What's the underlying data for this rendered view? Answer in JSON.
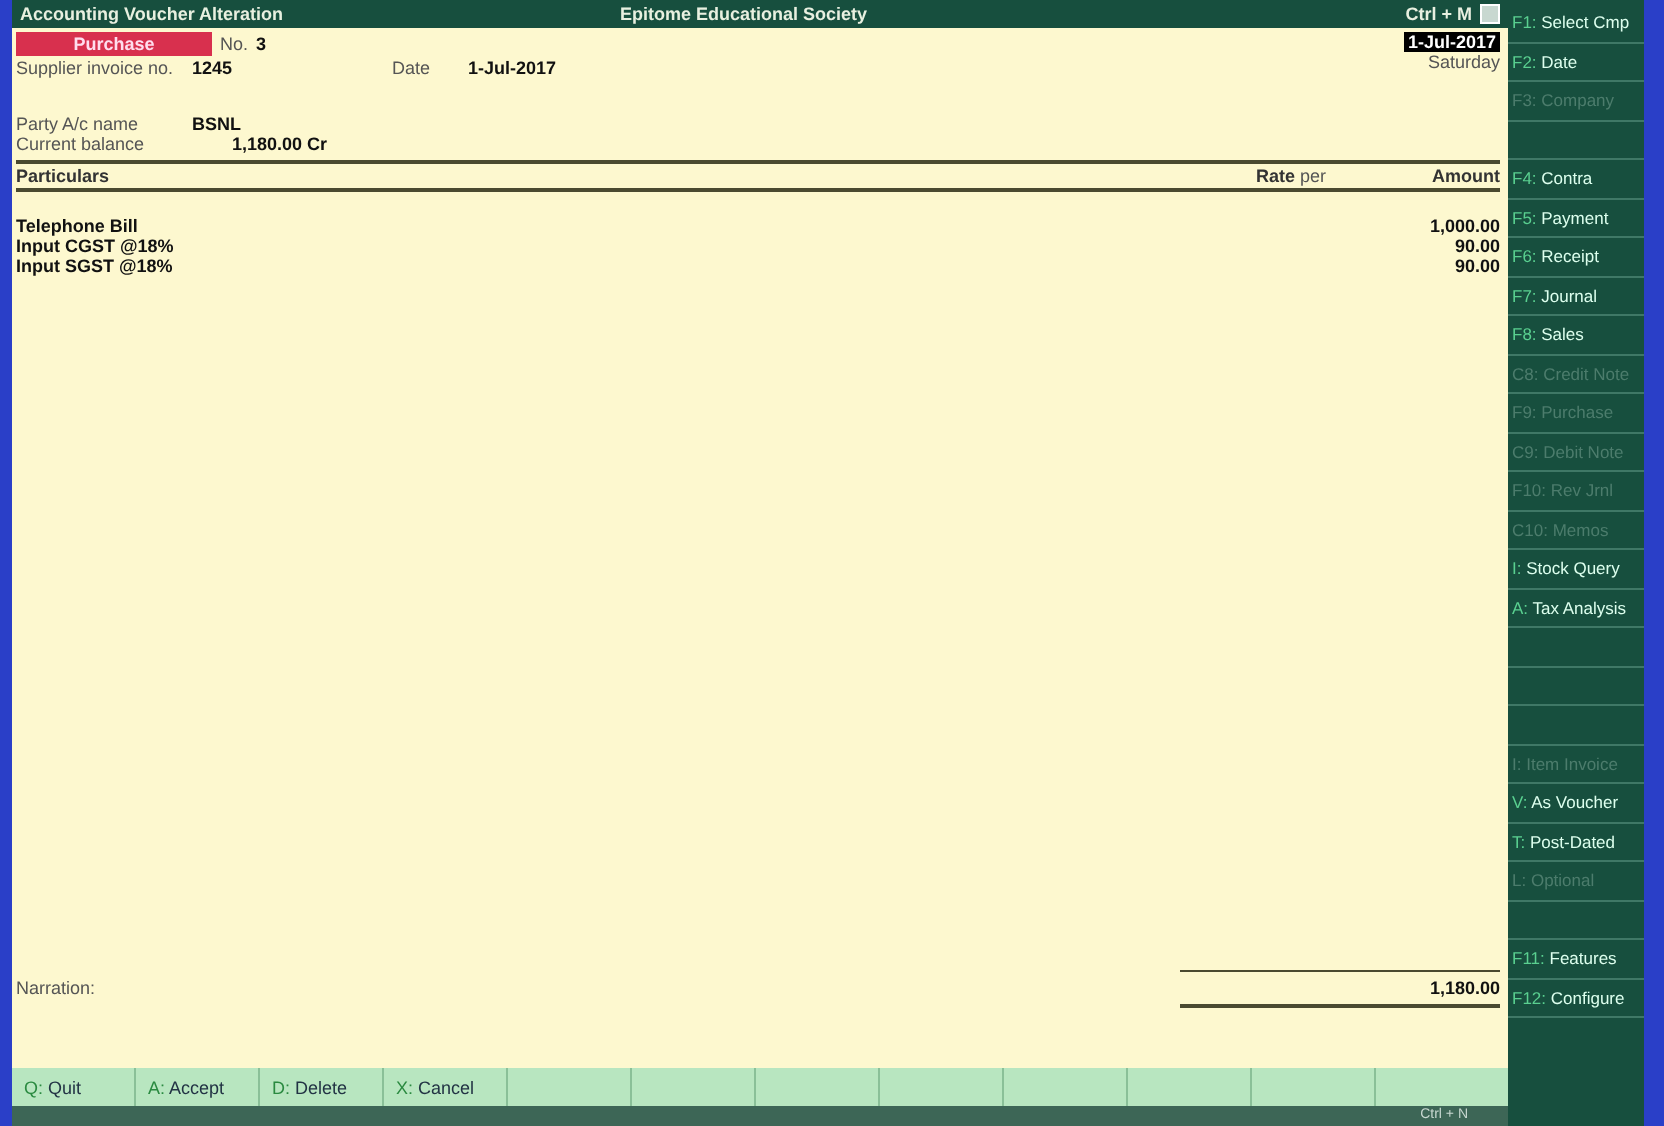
{
  "title_bar": {
    "left": "Accounting Voucher  Alteration",
    "center": "Epitome Educational Society",
    "right": "Ctrl + M"
  },
  "voucher": {
    "type": "Purchase",
    "number_label": "No.",
    "number": "3",
    "date": "1-Jul-2017",
    "day": "Saturday",
    "fields": [
      {
        "label": "Supplier invoice no.",
        "value": "1245"
      },
      {
        "label": "Date",
        "value": "1-Jul-2017"
      }
    ],
    "party": [
      {
        "label": "Party A/c name",
        "value": "BSNL"
      },
      {
        "label": "Current balance",
        "value": "1,180.00 Cr"
      }
    ]
  },
  "table": {
    "columns": [
      "Particulars",
      "Rate",
      "per",
      "Amount"
    ],
    "rows": [
      {
        "particulars": "Telephone Bill",
        "amount": "1,000.00"
      },
      {
        "particulars": "Input CGST @18%",
        "amount": "90.00"
      },
      {
        "particulars": "Input SGST @18%",
        "amount": "90.00"
      }
    ]
  },
  "narration": {
    "label": "Narration:",
    "total": "1,180.00"
  },
  "bottom_buttons": [
    {
      "key": "Q:",
      "label": "Quit"
    },
    {
      "key": "A:",
      "label": "Accept"
    },
    {
      "key": "D:",
      "label": "Delete"
    },
    {
      "key": "X:",
      "label": "Cancel"
    }
  ],
  "status_bar": {
    "text": "Ctrl + N"
  },
  "sidebar": [
    {
      "kind": "button",
      "key": "F1:",
      "label": "Select Cmp",
      "disabled": false
    },
    {
      "kind": "button",
      "key": "F2:",
      "label": "Date",
      "disabled": false
    },
    {
      "kind": "button",
      "key": "F3:",
      "label": "Company",
      "disabled": true
    },
    {
      "kind": "spacer"
    },
    {
      "kind": "button",
      "key": "F4:",
      "label": "Contra",
      "disabled": false
    },
    {
      "kind": "button",
      "key": "F5:",
      "label": "Payment",
      "disabled": false
    },
    {
      "kind": "button",
      "key": "F6:",
      "label": "Receipt",
      "disabled": false
    },
    {
      "kind": "button",
      "key": "F7:",
      "label": "Journal",
      "disabled": false
    },
    {
      "kind": "button",
      "key": "F8:",
      "label": "Sales",
      "disabled": false
    },
    {
      "kind": "button",
      "key": "C8:",
      "label": "Credit Note",
      "disabled": true
    },
    {
      "kind": "button",
      "key": "F9:",
      "label": "Purchase",
      "disabled": true
    },
    {
      "kind": "button",
      "key": "C9:",
      "label": "Debit Note",
      "disabled": true
    },
    {
      "kind": "button",
      "key": "F10:",
      "label": "Rev Jrnl",
      "disabled": true
    },
    {
      "kind": "button",
      "key": "C10:",
      "label": "Memos",
      "disabled": true
    },
    {
      "kind": "button",
      "key": "I:",
      "label": "Stock Query",
      "disabled": false
    },
    {
      "kind": "button",
      "key": "A:",
      "label": "Tax Analysis",
      "disabled": false
    },
    {
      "kind": "spacer"
    },
    {
      "kind": "spacer"
    },
    {
      "kind": "spacer"
    },
    {
      "kind": "button",
      "key": "I:",
      "label": "Item Invoice",
      "disabled": true
    },
    {
      "kind": "button",
      "key": "V:",
      "label": "As Voucher",
      "disabled": false
    },
    {
      "kind": "button",
      "key": "T:",
      "label": "Post-Dated",
      "disabled": false
    },
    {
      "kind": "button",
      "key": "L:",
      "label": "Optional",
      "disabled": true
    },
    {
      "kind": "spacer"
    },
    {
      "kind": "button",
      "key": "F11:",
      "label": "Features",
      "disabled": false
    },
    {
      "kind": "button",
      "key": "F12:",
      "label": "Configure",
      "disabled": false
    }
  ]
}
